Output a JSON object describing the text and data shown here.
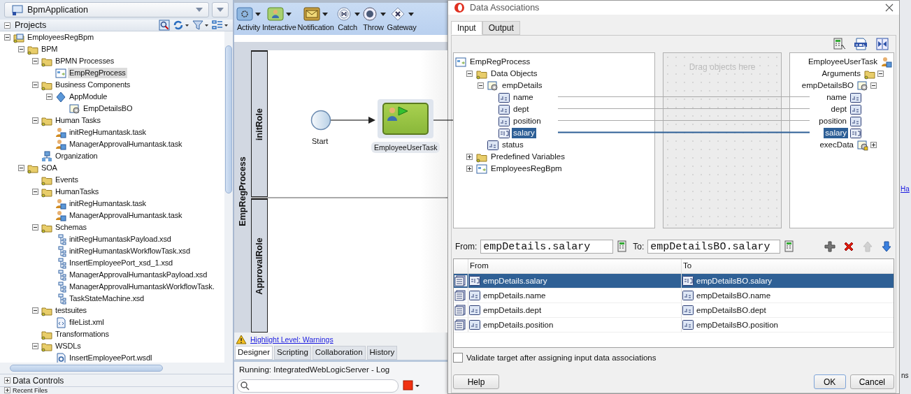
{
  "app_selector": {
    "value": "BpmApplication"
  },
  "projects": {
    "title": "Projects",
    "expanded": true,
    "tree": [
      {
        "label": "EmployeesRegBpm",
        "kind": "project",
        "selected": false,
        "expanded": true,
        "children": [
          {
            "label": "BPM",
            "kind": "folder",
            "selected": false,
            "expanded": true,
            "children": [
              {
                "label": "BPMN Processes",
                "kind": "folder",
                "selected": false,
                "expanded": true,
                "children": [
                  {
                    "label": "EmpRegProcess",
                    "kind": "process",
                    "selected": true
                  }
                ]
              },
              {
                "label": "Business Components",
                "kind": "folder",
                "selected": false,
                "expanded": true,
                "children": [
                  {
                    "label": "AppModule",
                    "kind": "module",
                    "selected": false,
                    "expanded": true,
                    "children": [
                      {
                        "label": "EmpDetailsBO",
                        "kind": "bo",
                        "selected": false
                      }
                    ]
                  }
                ]
              },
              {
                "label": "Human Tasks",
                "kind": "folder",
                "selected": false,
                "expanded": true,
                "children": [
                  {
                    "label": "initRegHumantask.task",
                    "kind": "task",
                    "selected": false
                  },
                  {
                    "label": "ManagerApprovalHumantask.task",
                    "kind": "task",
                    "selected": false
                  }
                ]
              },
              {
                "label": "Organization",
                "kind": "org",
                "selected": false
              }
            ]
          },
          {
            "label": "SOA",
            "kind": "folder",
            "selected": false,
            "expanded": true,
            "children": [
              {
                "label": "Events",
                "kind": "folder",
                "selected": false
              },
              {
                "label": "HumanTasks",
                "kind": "folder",
                "selected": false,
                "expanded": true,
                "children": [
                  {
                    "label": "initRegHumantask.task",
                    "kind": "task",
                    "selected": false
                  },
                  {
                    "label": "ManagerApprovalHumantask.task",
                    "kind": "task",
                    "selected": false
                  }
                ]
              },
              {
                "label": "Schemas",
                "kind": "folder",
                "selected": false,
                "expanded": true,
                "children": [
                  {
                    "label": "initRegHumantaskPayload.xsd",
                    "kind": "schema",
                    "selected": false
                  },
                  {
                    "label": "initRegHumantaskWorkflowTask.xsd",
                    "kind": "schema",
                    "selected": false
                  },
                  {
                    "label": "InsertEmployeePort_xsd_1.xsd",
                    "kind": "schema",
                    "selected": false
                  },
                  {
                    "label": "ManagerApprovalHumantaskPayload.xsd",
                    "kind": "schema",
                    "selected": false
                  },
                  {
                    "label": "ManagerApprovalHumantaskWorkflowTask.",
                    "kind": "schema",
                    "selected": false
                  },
                  {
                    "label": "TaskStateMachine.xsd",
                    "kind": "schema",
                    "selected": false
                  }
                ]
              },
              {
                "label": "testsuites",
                "kind": "folder",
                "selected": false,
                "expanded": true,
                "children": [
                  {
                    "label": "fileList.xml",
                    "kind": "xml",
                    "selected": false
                  }
                ]
              },
              {
                "label": "Transformations",
                "kind": "folder",
                "selected": false
              },
              {
                "label": "WSDLs",
                "kind": "folder",
                "selected": false,
                "expanded": true,
                "children": [
                  {
                    "label": "InsertEmployeePort.wsdl",
                    "kind": "wsdl",
                    "selected": false
                  }
                ]
              }
            ]
          }
        ]
      }
    ]
  },
  "accordion": [
    {
      "title": "Data Controls",
      "expanded": false
    },
    {
      "title": "Recent Files",
      "expanded": false
    }
  ],
  "palette": [
    {
      "label": "Activity",
      "kind": "activity"
    },
    {
      "label": "Interactive",
      "kind": "interactive"
    },
    {
      "label": "Notification",
      "kind": "notification"
    },
    {
      "label": "Catch",
      "kind": "catch"
    },
    {
      "label": "Throw",
      "kind": "throw"
    },
    {
      "label": "Gateway",
      "kind": "gateway"
    }
  ],
  "process": {
    "pool": "EmpRegProcess",
    "lanes": [
      "initRole",
      "ApprovalRole"
    ],
    "start": {
      "label": "Start"
    },
    "task": {
      "label": "EmployeeUserTask"
    }
  },
  "warning": {
    "link": "Highlight Level: Warnings"
  },
  "editor_tabs": [
    {
      "label": "Designer",
      "selected": true
    },
    {
      "label": "Scripting",
      "selected": false
    },
    {
      "label": "Collaboration",
      "selected": false
    },
    {
      "label": "History",
      "selected": false
    }
  ],
  "log": {
    "title": "Running: IntegratedWebLogicServer - Log"
  },
  "dialog": {
    "title": "Data Associations",
    "tabs": [
      {
        "label": "Input",
        "selected": true
      },
      {
        "label": "Output",
        "selected": false
      }
    ],
    "source_tree": [
      {
        "label": "EmpRegProcess",
        "kind": "process",
        "selected": false,
        "children": [
          {
            "label": "Data Objects",
            "kind": "folder",
            "selected": false,
            "expanded": true,
            "children": [
              {
                "label": "empDetails",
                "kind": "object",
                "selected": false,
                "expanded": true,
                "children": [
                  {
                    "label": "name",
                    "kind": "string",
                    "selected": false,
                    "mapped": true
                  },
                  {
                    "label": "dept",
                    "kind": "string",
                    "selected": false,
                    "mapped": true
                  },
                  {
                    "label": "position",
                    "kind": "string",
                    "selected": false,
                    "mapped": true
                  },
                  {
                    "label": "salary",
                    "kind": "number",
                    "selected": true,
                    "mapped": true
                  }
                ]
              },
              {
                "label": "status",
                "kind": "string",
                "selected": false,
                "mapped": false
              }
            ]
          },
          {
            "label": "Predefined Variables",
            "kind": "folder",
            "selected": false,
            "expanded": false
          },
          {
            "label": "EmployeesRegBpm",
            "kind": "process",
            "selected": false,
            "expanded": false
          }
        ]
      }
    ],
    "drop_hint": "Drag objects here",
    "target_tree": [
      {
        "label": "EmployeeUserTask",
        "kind": "task",
        "selected": false,
        "children": [
          {
            "label": "Arguments",
            "kind": "folder",
            "selected": false,
            "expanded": true,
            "children": [
              {
                "label": "empDetailsBO",
                "kind": "object",
                "selected": false,
                "expanded": true,
                "children": [
                  {
                    "label": "name",
                    "kind": "string",
                    "selected": false
                  },
                  {
                    "label": "dept",
                    "kind": "string",
                    "selected": false
                  },
                  {
                    "label": "position",
                    "kind": "string",
                    "selected": false
                  },
                  {
                    "label": "salary",
                    "kind": "number",
                    "selected": true
                  }
                ]
              },
              {
                "label": "execData",
                "kind": "locked",
                "selected": false,
                "expanded": false
              }
            ]
          }
        ]
      }
    ],
    "from_label": "From:",
    "from_value": "empDetails.salary",
    "to_label": "To:",
    "to_value": "empDetailsBO.salary",
    "actions": [
      {
        "kind": "add",
        "disabled": false
      },
      {
        "kind": "delete",
        "disabled": false
      },
      {
        "kind": "up",
        "disabled": true
      },
      {
        "kind": "down",
        "disabled": false
      }
    ],
    "table": {
      "columns": [
        "From",
        "To"
      ],
      "rows": [
        {
          "from": "empDetails.salary",
          "to": "empDetailsBO.salary",
          "kind": "number",
          "selected": true
        },
        {
          "from": "empDetails.name",
          "to": "empDetailsBO.name",
          "kind": "string",
          "selected": false
        },
        {
          "from": "empDetails.dept",
          "to": "empDetailsBO.dept",
          "kind": "string",
          "selected": false
        },
        {
          "from": "empDetails.position",
          "to": "empDetailsBO.position",
          "kind": "string",
          "selected": false
        }
      ]
    },
    "validate": {
      "label": "Validate target after assigning input data associations",
      "checked": false
    },
    "buttons": [
      {
        "label": "Help",
        "kind": "help"
      },
      {
        "label": "OK",
        "kind": "ok"
      },
      {
        "label": "Cancel",
        "kind": "cancel"
      }
    ]
  },
  "right_edge": {
    "link": "Ha",
    "text": "ns"
  }
}
